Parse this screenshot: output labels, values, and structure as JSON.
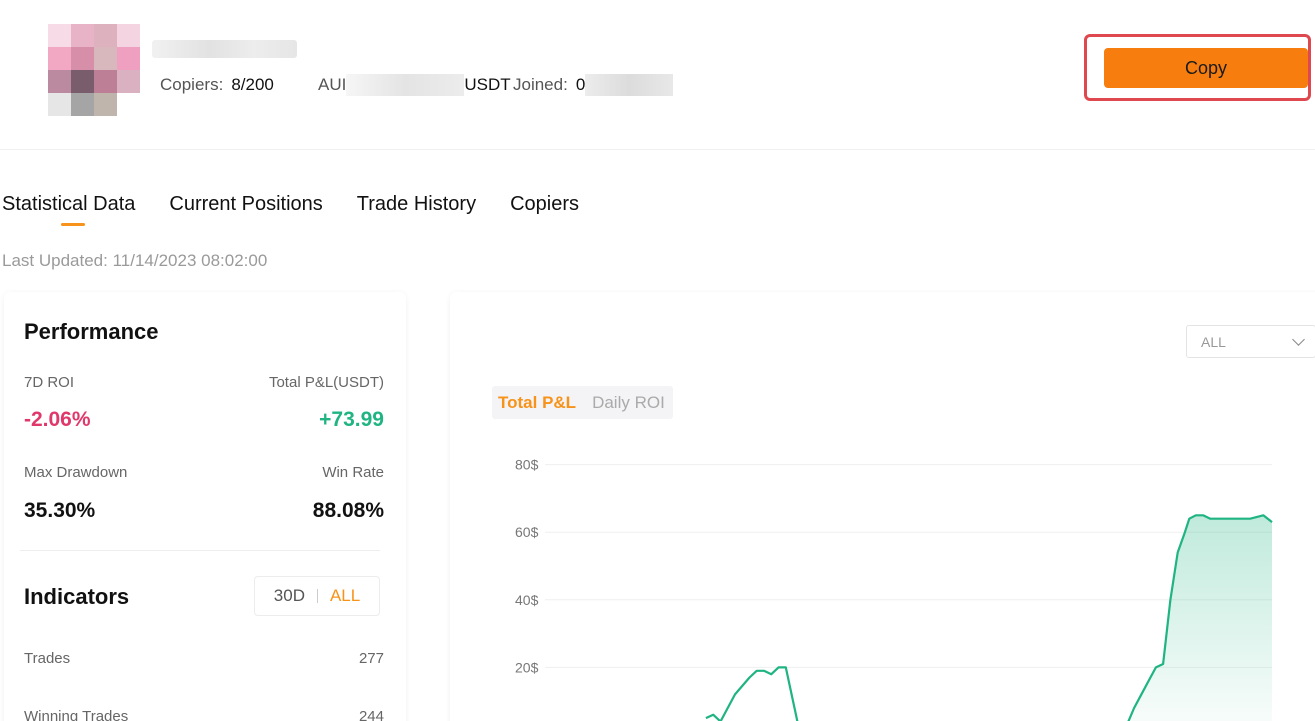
{
  "header": {
    "copiers_label": "Copiers:",
    "copiers_value": "8/200",
    "aum_label_start": "AUI",
    "aum_label_end": "USDT",
    "joined_label": "Joined:",
    "joined_value_start": "0",
    "copy_button": "Copy"
  },
  "tabs": [
    {
      "label": "Statistical Data"
    },
    {
      "label": "Current Positions"
    },
    {
      "label": "Trade History"
    },
    {
      "label": "Copiers"
    }
  ],
  "last_updated": "Last Updated: 11/14/2023 08:02:00",
  "performance": {
    "title": "Performance",
    "roi_7d_label": "7D ROI",
    "roi_7d_value": "-2.06%",
    "total_pnl_label": "Total P&L(USDT)",
    "total_pnl_value": "+73.99",
    "max_drawdown_label": "Max Drawdown",
    "max_drawdown_value": "35.30%",
    "win_rate_label": "Win Rate",
    "win_rate_value": "88.08%"
  },
  "indicators": {
    "title": "Indicators",
    "range_30d": "30D",
    "range_all": "ALL",
    "rows": [
      {
        "label": "Trades",
        "value": "277"
      },
      {
        "label": "Winning Trades",
        "value": "244"
      }
    ]
  },
  "chart_controls": {
    "period_select": "ALL",
    "tab_active": "Total P&L",
    "tab_other": "Daily ROI"
  },
  "colors": {
    "accent": "#f77d0e",
    "positive": "#1fb481",
    "negative": "#e0386b",
    "highlight_frame": "#e0484f"
  },
  "chart_data": {
    "type": "area",
    "title": "",
    "xlabel": "",
    "ylabel": "",
    "y_tick_labels": [
      "80$",
      "60$",
      "40$",
      "20$"
    ],
    "y_ticks": [
      80,
      60,
      40,
      20
    ],
    "ylim": [
      0,
      100
    ],
    "grid": true,
    "x_index_range": [
      0,
      100
    ],
    "series": [
      {
        "x": [
          27,
          28,
          29,
          31,
          33,
          34,
          35,
          36,
          37,
          38,
          40,
          55,
          84,
          85,
          86,
          88,
          89,
          90,
          91,
          92,
          93,
          93.6,
          94.5,
          95.5,
          96.5,
          100,
          101,
          102,
          103.8,
          105
        ],
        "y": [
          5,
          6,
          4,
          12,
          17,
          19,
          19,
          18,
          20,
          20,
          0,
          0,
          0,
          3,
          8,
          16,
          20,
          21,
          40,
          54,
          60,
          64,
          65,
          65,
          64,
          64,
          64,
          64,
          65,
          63
        ]
      }
    ]
  }
}
